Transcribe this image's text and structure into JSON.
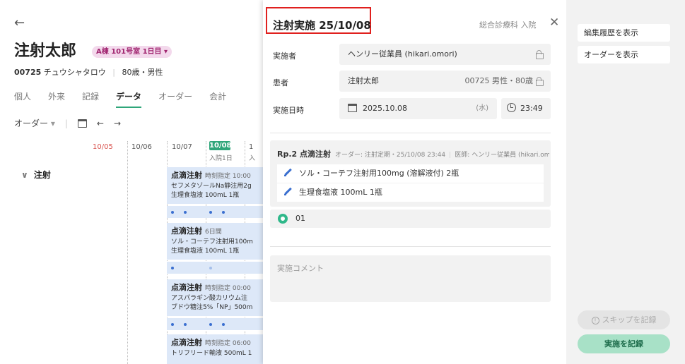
{
  "patient": {
    "name": "注射太郎",
    "room_badge": "A棟 101号室 1日目",
    "id": "00725",
    "kana": "チュウシャタロウ",
    "age_sex": "80歳・男性"
  },
  "tabs": [
    {
      "label": "個人"
    },
    {
      "label": "外来"
    },
    {
      "label": "記録"
    },
    {
      "label": "データ",
      "active": true
    },
    {
      "label": "オーダー"
    },
    {
      "label": "会計"
    }
  ],
  "toolbar": {
    "order_filter": "オーダー"
  },
  "timeline": {
    "dates": [
      "10/05",
      "10/06",
      "10/07",
      "10/08",
      "1"
    ],
    "today_badge": "10/08",
    "admit_label": "入院1日",
    "admit_label_cut": "入",
    "section": "注射",
    "cards": [
      {
        "title": "点滴注射",
        "sub": "時刻指定 10:00",
        "lines": [
          "セフメタゾールNa静注用2g",
          "生理食塩液 100mL 1瓶"
        ]
      },
      {
        "title": "点滴注射",
        "sub": "6日間",
        "lines": [
          "ソル・コーテフ注射用100m",
          "生理食塩液 100mL 1瓶"
        ]
      },
      {
        "title": "点滴注射",
        "sub": "時刻指定 00:00",
        "lines": [
          "アスパラギン酸カリウム注",
          "ブドウ糖注5%「NP」500m"
        ]
      },
      {
        "title": "点滴注射",
        "sub": "時刻指定 06:00",
        "lines": [
          "トリフリード輸液 500mL 1"
        ]
      }
    ]
  },
  "dialog": {
    "title": "注射実施 25/10/08",
    "dept": "総合診療科 入院",
    "performer_label": "実施者",
    "performer_value": "ヘンリー従業員 (hikari.omori)",
    "patient_label": "患者",
    "patient_value": "注射太郎",
    "patient_right": "00725 男性・80歳",
    "datetime_label": "実施日時",
    "date_value": "2025.10.08",
    "weekday": "(水)",
    "time_value": "23:49",
    "rp_title": "Rp.2 点滴注射",
    "rp_order": "オーダー: 注射定期・25/10/08 23:44",
    "rp_doctor": "医師: ヘンリー従業員 (hikari.omori)",
    "drugs": [
      "ソル・コーテフ注射用100mg (溶解液付) 2瓶",
      "生理食塩液 100mL 1瓶"
    ],
    "status_value": "01",
    "comment_placeholder": "実施コメント"
  },
  "side": {
    "edit_history": "編集履歴を表示",
    "show_order": "オーダーを表示",
    "skip": "スキップを記録",
    "record": "実施を記録"
  },
  "colors": {
    "accent": "#2fa67a",
    "badge_bg": "#f3d9ec",
    "highlight_border": "#e0201e",
    "card_bg": "#dde8f8",
    "record_btn": "#a8e1c7"
  }
}
